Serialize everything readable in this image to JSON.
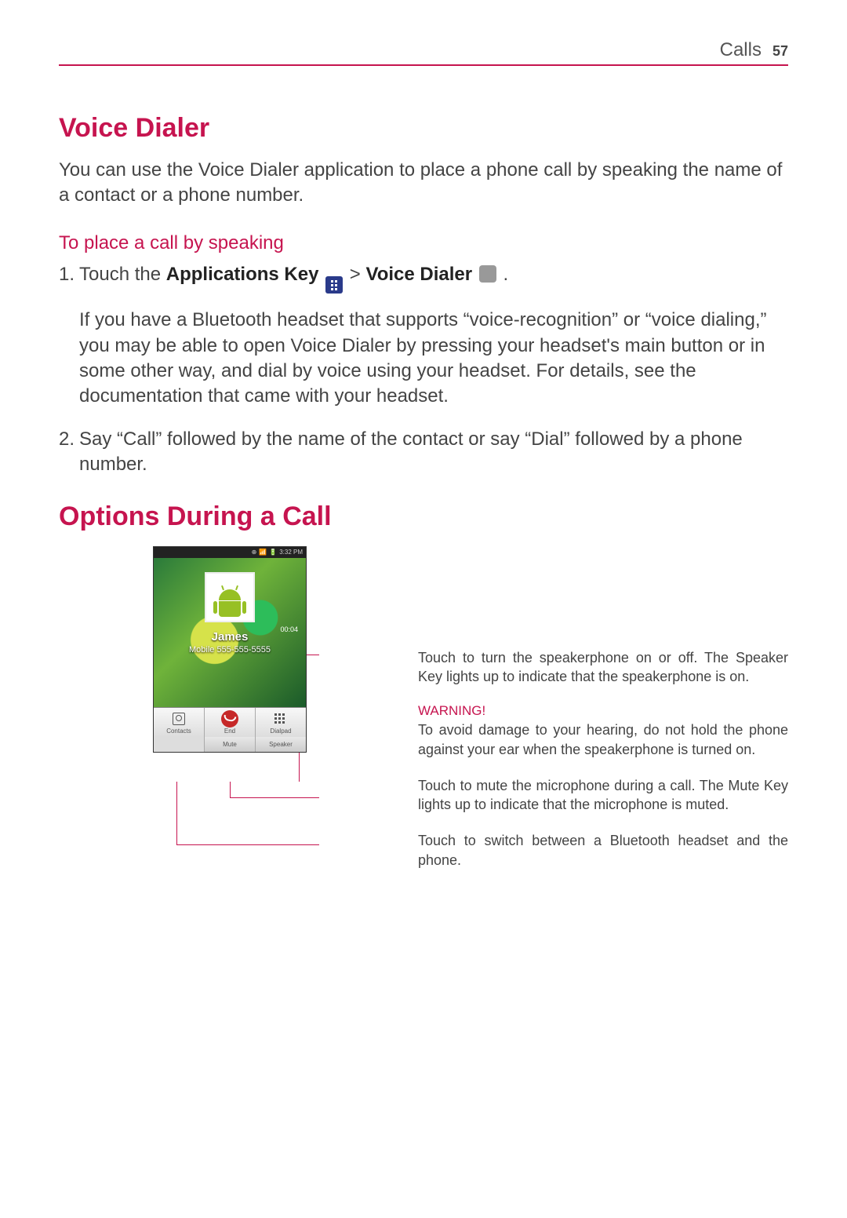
{
  "header": {
    "section": "Calls",
    "page_number": "57"
  },
  "section1": {
    "title": "Voice Dialer",
    "intro": "You can use the Voice Dialer application to place a phone call by speaking the name of a contact or a phone number.",
    "subheading": "To place a call by speaking",
    "step1_num": "1.",
    "step1_pre": "Touch the ",
    "step1_bold1": "Applications Key",
    "step1_mid": " > ",
    "step1_bold2": "Voice Dialer",
    "step1_post": " .",
    "step1_detail": "If you have a Bluetooth headset that supports “voice-recognition” or “voice dialing,” you may be able to open Voice Dialer by pressing your headset's main button or in some other way, and dial by voice using your headset. For details, see the documentation that came with your headset.",
    "step2_num": "2.",
    "step2_text": "Say “Call” followed by the name of the contact or say “Dial” followed by a phone number."
  },
  "section2": {
    "title": "Options During a Call",
    "phone": {
      "status_time": "3:32 PM",
      "timer": "00:04",
      "caller_name": "James",
      "caller_number": "Mobile 555-555-5555",
      "btn_contacts": "Contacts",
      "btn_end": "End",
      "btn_dialpad": "Dialpad",
      "btn_mute": "Mute",
      "btn_speaker": "Speaker"
    },
    "callouts": {
      "speaker": "Touch to turn the speakerphone on or off. The Speaker Key lights up to indicate that the speakerphone is on.",
      "warning_label": "WARNING!",
      "warning_text": "To avoid damage to your hearing, do not hold the phone against your ear when the speakerphone is turned on.",
      "mute": "Touch to mute the microphone during a call. The Mute Key lights up to indicate that the microphone is muted.",
      "bluetooth": "Touch to switch between a Bluetooth headset and the phone."
    }
  }
}
